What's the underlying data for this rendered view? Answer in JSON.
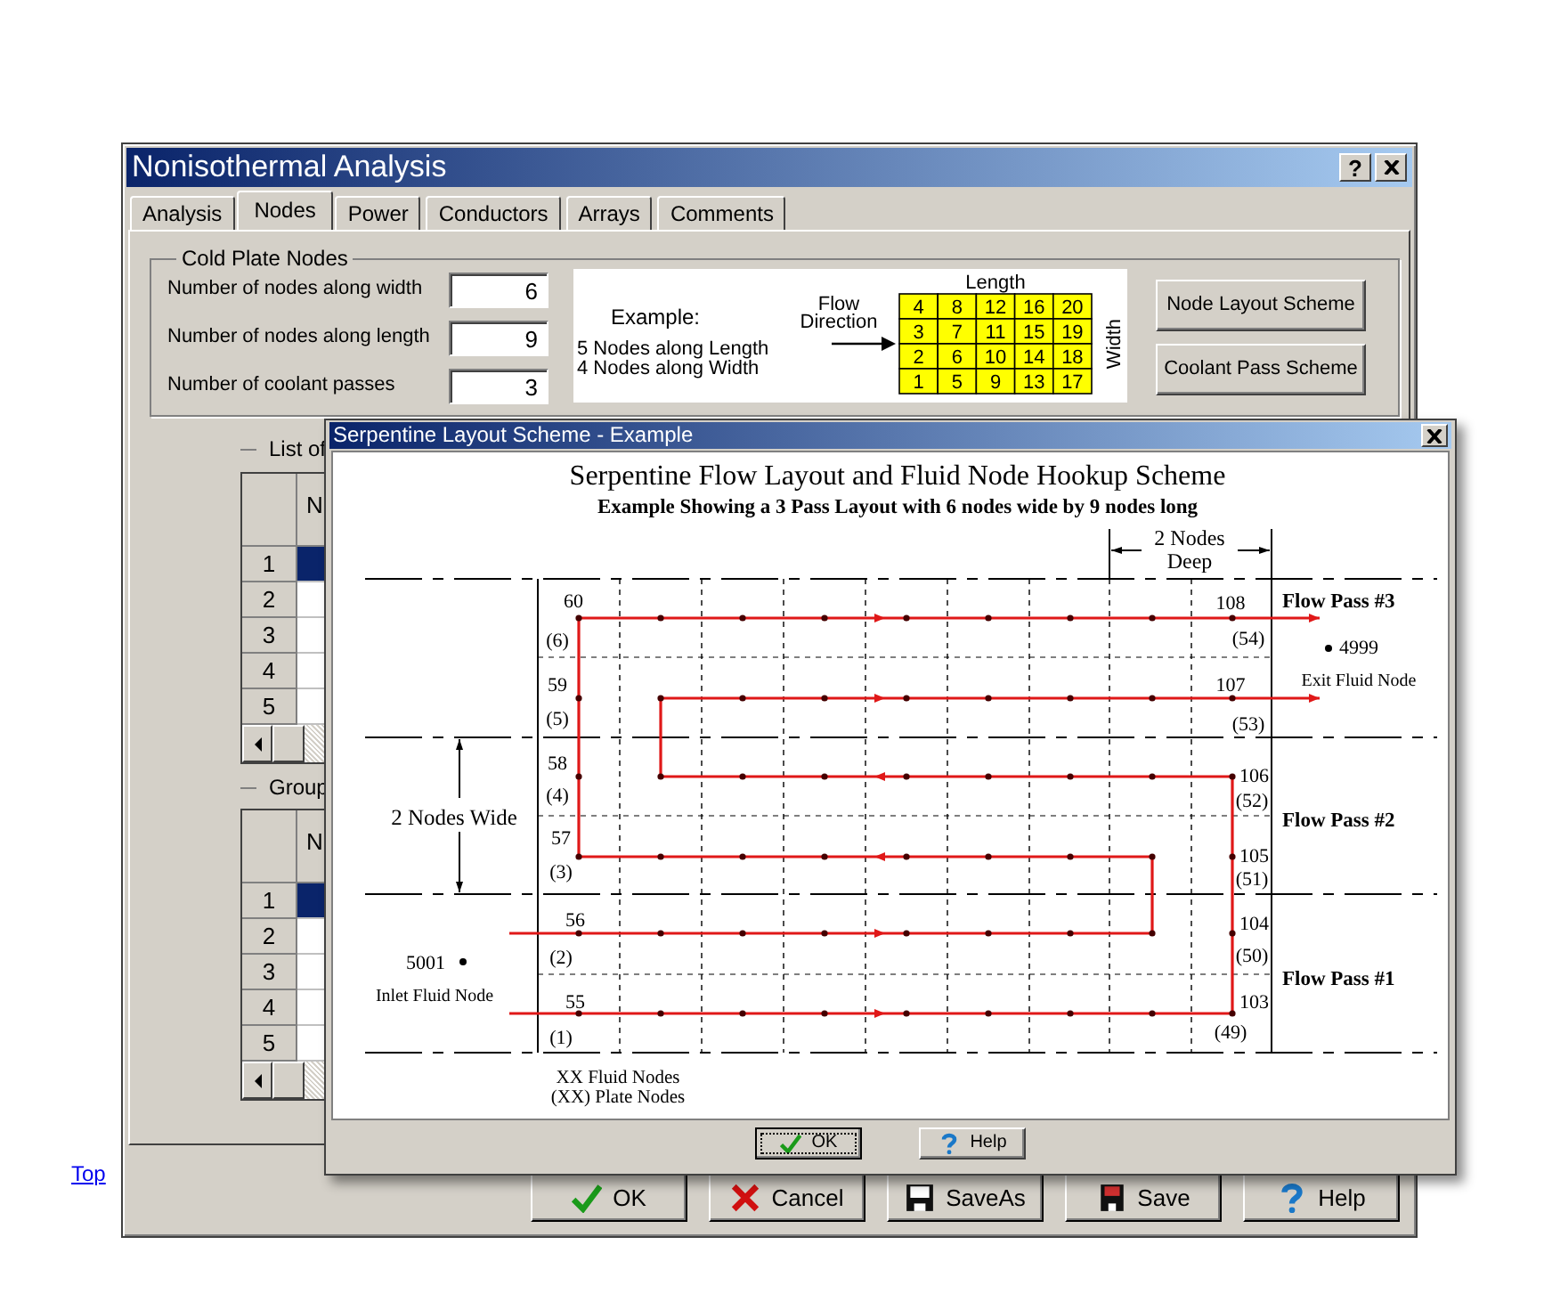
{
  "main_window": {
    "title": "Nonisothermal Analysis",
    "help_glyph": "?",
    "tabs": [
      {
        "label": "Analysis",
        "selected": false
      },
      {
        "label": "Nodes",
        "selected": true
      },
      {
        "label": "Power",
        "selected": false
      },
      {
        "label": "Conductors",
        "selected": false
      },
      {
        "label": "Arrays",
        "selected": false
      },
      {
        "label": "Comments",
        "selected": false
      }
    ],
    "cold_plate_group": {
      "title": "Cold Plate Nodes",
      "fields": [
        {
          "label": "Number of nodes along width",
          "value": "6"
        },
        {
          "label": "Number of nodes along length",
          "value": "9"
        },
        {
          "label": "Number of coolant passes",
          "value": "3"
        }
      ],
      "example": {
        "heading": "Example:",
        "lines": [
          "5 Nodes along Length",
          "4 Nodes along Width"
        ],
        "flow_lines": [
          "Flow",
          "Direction"
        ],
        "length_label": "Length",
        "width_label": "Width",
        "grid": [
          [
            "4",
            "8",
            "12",
            "16",
            "20"
          ],
          [
            "3",
            "7",
            "11",
            "15",
            "19"
          ],
          [
            "2",
            "6",
            "10",
            "14",
            "18"
          ],
          [
            "1",
            "5",
            "9",
            "13",
            "17"
          ]
        ]
      },
      "buttons": [
        "Node Layout Scheme",
        "Coolant Pass Scheme"
      ]
    },
    "lists": [
      {
        "title": "List of",
        "header": "N",
        "rows": [
          {
            "label": "1",
            "selected": true
          },
          {
            "label": "2",
            "selected": false
          },
          {
            "label": "3",
            "selected": false
          },
          {
            "label": "4",
            "selected": false
          },
          {
            "label": "5",
            "selected": false
          }
        ]
      },
      {
        "title": "Group",
        "header": "N",
        "rows": [
          {
            "label": "1",
            "selected": true
          },
          {
            "label": "2",
            "selected": false
          },
          {
            "label": "3",
            "selected": false
          },
          {
            "label": "4",
            "selected": false
          },
          {
            "label": "5",
            "selected": false
          }
        ]
      }
    ],
    "buttons": [
      {
        "kind": "ok",
        "label": "OK"
      },
      {
        "kind": "cancel",
        "label": "Cancel"
      },
      {
        "kind": "save_as",
        "label": "SaveAs"
      },
      {
        "kind": "save",
        "label": "Save"
      },
      {
        "kind": "help",
        "label": "Help"
      }
    ]
  },
  "popup": {
    "title": "Serpentine Layout Scheme - Example",
    "diagram": {
      "title": "Serpentine Flow Layout and Fluid Node Hookup Scheme",
      "subtitle": "Example Showing a 3 Pass Layout with 6 nodes wide by 9 nodes long",
      "depth_label": [
        "2 Nodes",
        "Deep"
      ],
      "width_label": "2 Nodes Wide",
      "left_nodes": [
        {
          "fluid": "60",
          "plate": "(6)"
        },
        {
          "fluid": "59",
          "plate": "(5)"
        },
        {
          "fluid": "58",
          "plate": "(4)"
        },
        {
          "fluid": "57",
          "plate": "(3)"
        },
        {
          "fluid": "56",
          "plate": "(2)"
        },
        {
          "fluid": "55",
          "plate": "(1)"
        }
      ],
      "right_nodes": [
        {
          "fluid": "108",
          "plate": "(54)"
        },
        {
          "fluid": "107",
          "plate": "(53)"
        },
        {
          "fluid": "106",
          "plate": "(52)"
        },
        {
          "fluid": "105",
          "plate": "(51)"
        },
        {
          "fluid": "104",
          "plate": "(50)"
        },
        {
          "fluid": "103",
          "plate": "(49)"
        }
      ],
      "passes": [
        "Flow Pass #3",
        "Flow Pass #2",
        "Flow Pass #1"
      ],
      "exit_node": {
        "number": "4999",
        "label": "Exit Fluid Node"
      },
      "inlet_node": {
        "number": "5001",
        "label": "Inlet Fluid Node"
      },
      "legend": [
        "XX Fluid Nodes",
        "(XX) Plate Nodes"
      ]
    },
    "buttons": [
      {
        "kind": "ok",
        "label": "OK",
        "focused": true
      },
      {
        "kind": "help",
        "label": "Help",
        "focused": false
      }
    ]
  },
  "top_link": "Top"
}
